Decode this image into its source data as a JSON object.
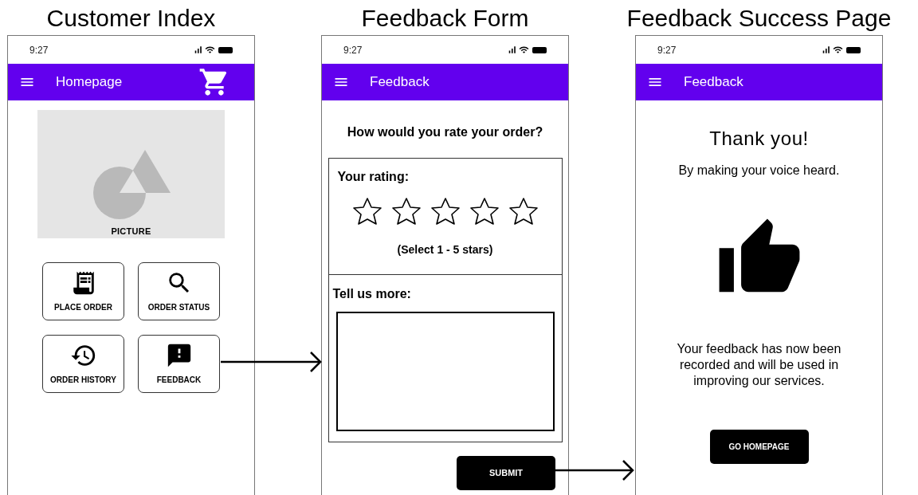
{
  "screens": [
    {
      "kind": "home",
      "caption": "Customer Index",
      "status_time": "9:27",
      "app_bar_title": "Homepage",
      "picture_label": "PICTURE",
      "tiles": [
        {
          "label": "PLACE ORDER"
        },
        {
          "label": "ORDER STATUS"
        },
        {
          "label": "ORDER HISTORY"
        },
        {
          "label": "FEEDBACK"
        }
      ]
    },
    {
      "kind": "form",
      "caption": "Feedback Form",
      "status_time": "9:27",
      "app_bar_title": "Feedback",
      "question": "How would you rate your order?",
      "rating_label": "Your rating:",
      "stars": 0,
      "rating_hint": "(Select 1 - 5 stars)",
      "comment_label": "Tell us more:",
      "submit": "SUBMIT"
    },
    {
      "kind": "success",
      "caption": "Feedback Success Page",
      "status_time": "9:27",
      "app_bar_title": "Feedback",
      "heading": "Thank you!",
      "subheading": "By making your voice heard.",
      "message": "Your feedback has now been recorded and will be used in improving our services.",
      "button": "GO HOMEPAGE"
    }
  ]
}
